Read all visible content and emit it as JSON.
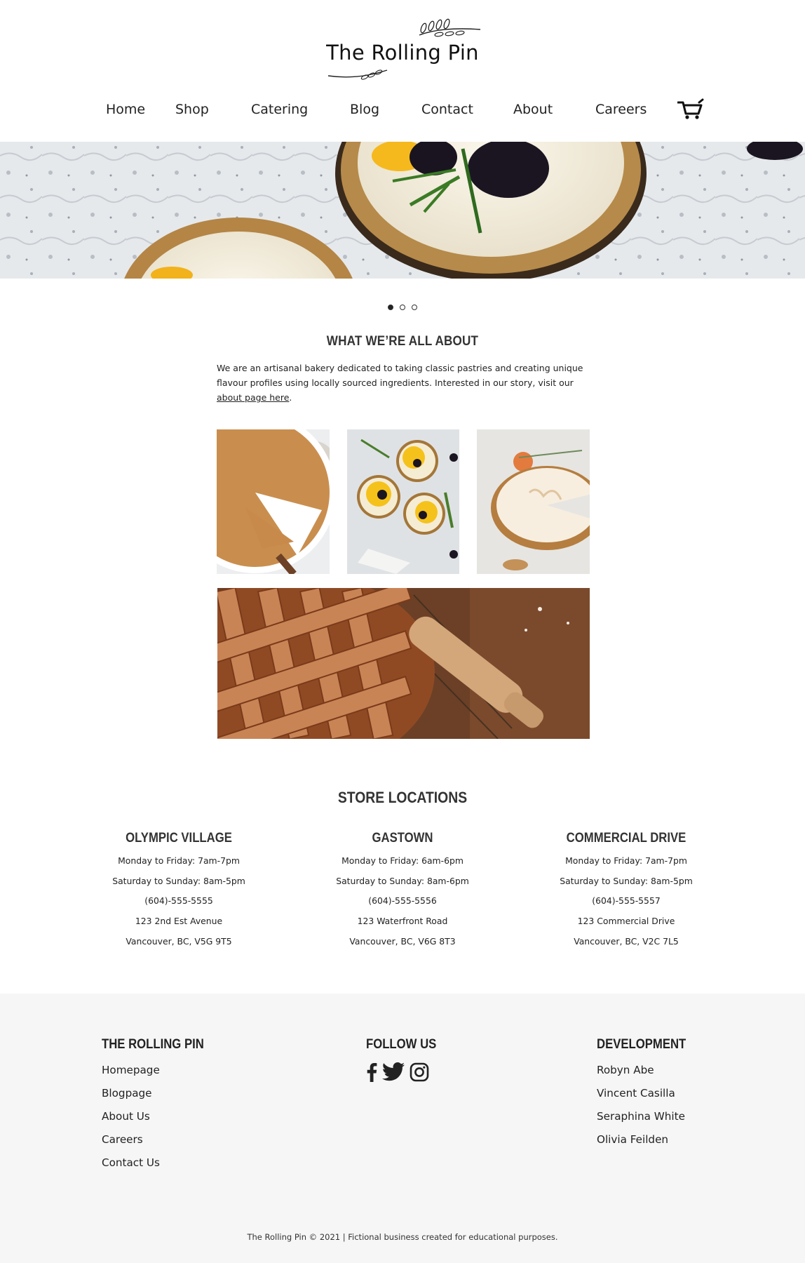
{
  "brand": {
    "name": "The Rolling Pin"
  },
  "nav": {
    "items": [
      {
        "label": "Home"
      },
      {
        "label": "Shop"
      },
      {
        "label": "Catering"
      },
      {
        "label": "Blog"
      },
      {
        "label": "Contact"
      },
      {
        "label": "About"
      },
      {
        "label": "Careers"
      }
    ],
    "cart_icon": "shopping-cart-icon"
  },
  "hero": {
    "slides": 3,
    "active_slide": 1
  },
  "about": {
    "title": "WHAT WE’RE ALL ABOUT",
    "text_before_link": "We are an artisanal bakery dedicated to taking classic pastries and creating unique flavour profiles using locally sourced ingredients. Interested in our story, visit our ",
    "link_text": "about page here",
    "text_after_link": "."
  },
  "stores": {
    "title": "STORE LOCATIONS",
    "locations": [
      {
        "name": "OLYMPIC VILLAGE",
        "weekday": "Monday to Friday: 7am-7pm",
        "weekend": "Saturday to Sunday: 8am-5pm",
        "phone": "(604)-555-5555",
        "street": "123 2nd Est Avenue",
        "city": "Vancouver, BC, V5G 9T5"
      },
      {
        "name": "GASTOWN",
        "weekday": "Monday to Friday: 6am-6pm",
        "weekend": "Saturday to Sunday: 8am-6pm",
        "phone": "(604)-555-5556",
        "street": "123 Waterfront Road",
        "city": "Vancouver, BC, V6G 8T3"
      },
      {
        "name": "COMMERCIAL DRIVE",
        "weekday": "Monday to Friday: 7am-7pm",
        "weekend": "Saturday to Sunday: 8am-5pm",
        "phone": "(604)-555-5557",
        "street": "123 Commercial Drive",
        "city": "Vancouver, BC, V2C 7L5"
      }
    ]
  },
  "footer": {
    "col1": {
      "title": "THE ROLLING PIN",
      "links": [
        "Homepage",
        "Blogpage",
        "About Us",
        "Careers",
        "Contact Us"
      ]
    },
    "col2": {
      "title": "FOLLOW US",
      "icons": [
        "facebook-icon",
        "twitter-icon",
        "instagram-icon"
      ]
    },
    "col3": {
      "title": "DEVELOPMENT",
      "links": [
        "Robyn Abe",
        "Vincent Casilla",
        "Seraphina White",
        "Olivia Feilden"
      ]
    },
    "copyright": "The Rolling Pin © 2021 | Fictional business created for educational purposes."
  },
  "colors": {
    "footer_bg": "#f6f6f6",
    "text": "#222222",
    "heading": "#333333"
  }
}
